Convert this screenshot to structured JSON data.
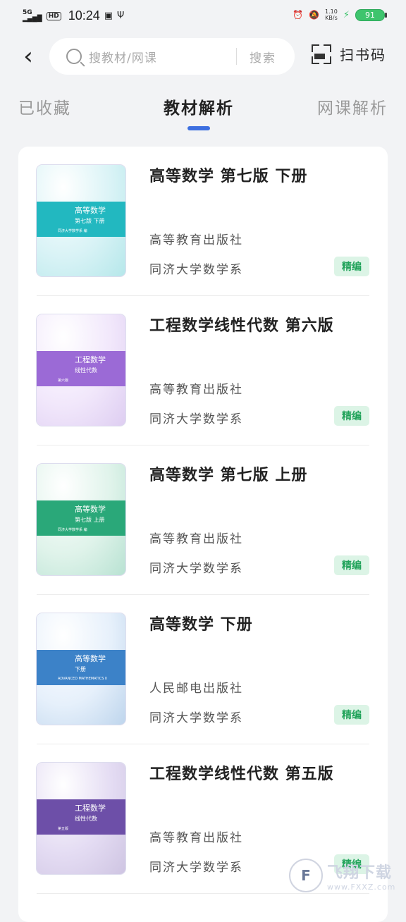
{
  "status_bar": {
    "network": "5G",
    "hd": "HD",
    "time": "10:24",
    "net_speed": "1.10",
    "net_unit": "KB/s",
    "battery": "91"
  },
  "header": {
    "search_placeholder": "搜教材/网课",
    "search_button": "搜索",
    "scan_label": "扫书码"
  },
  "tabs": [
    {
      "label": "已收藏",
      "active": false
    },
    {
      "label": "教材解析",
      "active": true
    },
    {
      "label": "网课解析",
      "active": false
    }
  ],
  "books": [
    {
      "title": "高等数学 第七版 下册",
      "publisher": "高等教育出版社",
      "author": "同济大学数学系",
      "badge": "精编",
      "cover": {
        "line1": "高等数学",
        "line2": "第七版 下册",
        "small": "同济大学数学系 编",
        "color": "#22b8c0",
        "bg": "#d9f3f6"
      }
    },
    {
      "title": "工程数学线性代数 第六版",
      "publisher": "高等教育出版社",
      "author": "同济大学数学系",
      "badge": "精编",
      "cover": {
        "line1": "工程数学",
        "line2": "线性代数",
        "small": "第六版",
        "color": "#9b6ad6",
        "bg": "#f1e7fb"
      }
    },
    {
      "title": "高等数学 第七版 上册",
      "publisher": "高等教育出版社",
      "author": "同济大学数学系",
      "badge": "精编",
      "cover": {
        "line1": "高等数学",
        "line2": "第七版 上册",
        "small": "同济大学数学系 编",
        "color": "#2aa879",
        "bg": "#dff3ea"
      }
    },
    {
      "title": "高等数学 下册",
      "publisher": "人民邮电出版社",
      "author": "同济大学数学系",
      "badge": "精编",
      "cover": {
        "line1": "高等数学",
        "line2": "下册",
        "small": "ADVANCED MATHEMATICS II",
        "color": "#3c82c8",
        "bg": "#e6f0fb"
      }
    },
    {
      "title": "工程数学线性代数 第五版",
      "publisher": "高等教育出版社",
      "author": "同济大学数学系",
      "badge": "精编",
      "cover": {
        "line1": "工程数学",
        "line2": "线性代数",
        "small": "第五版",
        "color": "#6d4fa8",
        "bg": "#e4dcf3"
      }
    }
  ],
  "watermark": {
    "text": "飞翔下载",
    "url": "www.FXXZ.com"
  }
}
